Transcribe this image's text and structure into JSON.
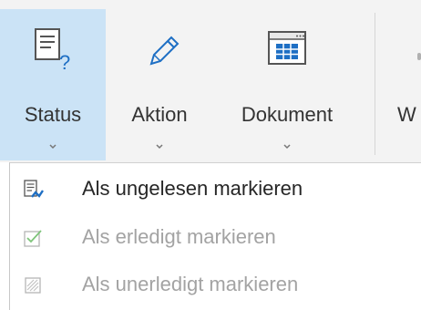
{
  "ribbon": {
    "buttons": [
      {
        "label": "Status",
        "icon": "status-icon",
        "active": true
      },
      {
        "label": "Aktion",
        "icon": "pencil-icon",
        "active": false
      },
      {
        "label": "Dokument",
        "icon": "document-table-icon",
        "active": false
      },
      {
        "label": "W",
        "icon": "unknown-icon",
        "active": false
      }
    ]
  },
  "status_menu": {
    "items": [
      {
        "label": "Als ungelesen markieren",
        "icon": "mark-unread-icon",
        "enabled": true
      },
      {
        "label": "Als erledigt markieren",
        "icon": "checkbox-checked-icon",
        "enabled": false
      },
      {
        "label": "Als unerledigt markieren",
        "icon": "checkbox-hatched-icon",
        "enabled": false
      }
    ]
  },
  "colors": {
    "ribbon_background": "#f3f3f3",
    "active_button": "#cbe3f6",
    "icon_blue": "#1e6fc4",
    "disabled_text": "#a3a3a3",
    "check_green": "#7ec47a"
  }
}
